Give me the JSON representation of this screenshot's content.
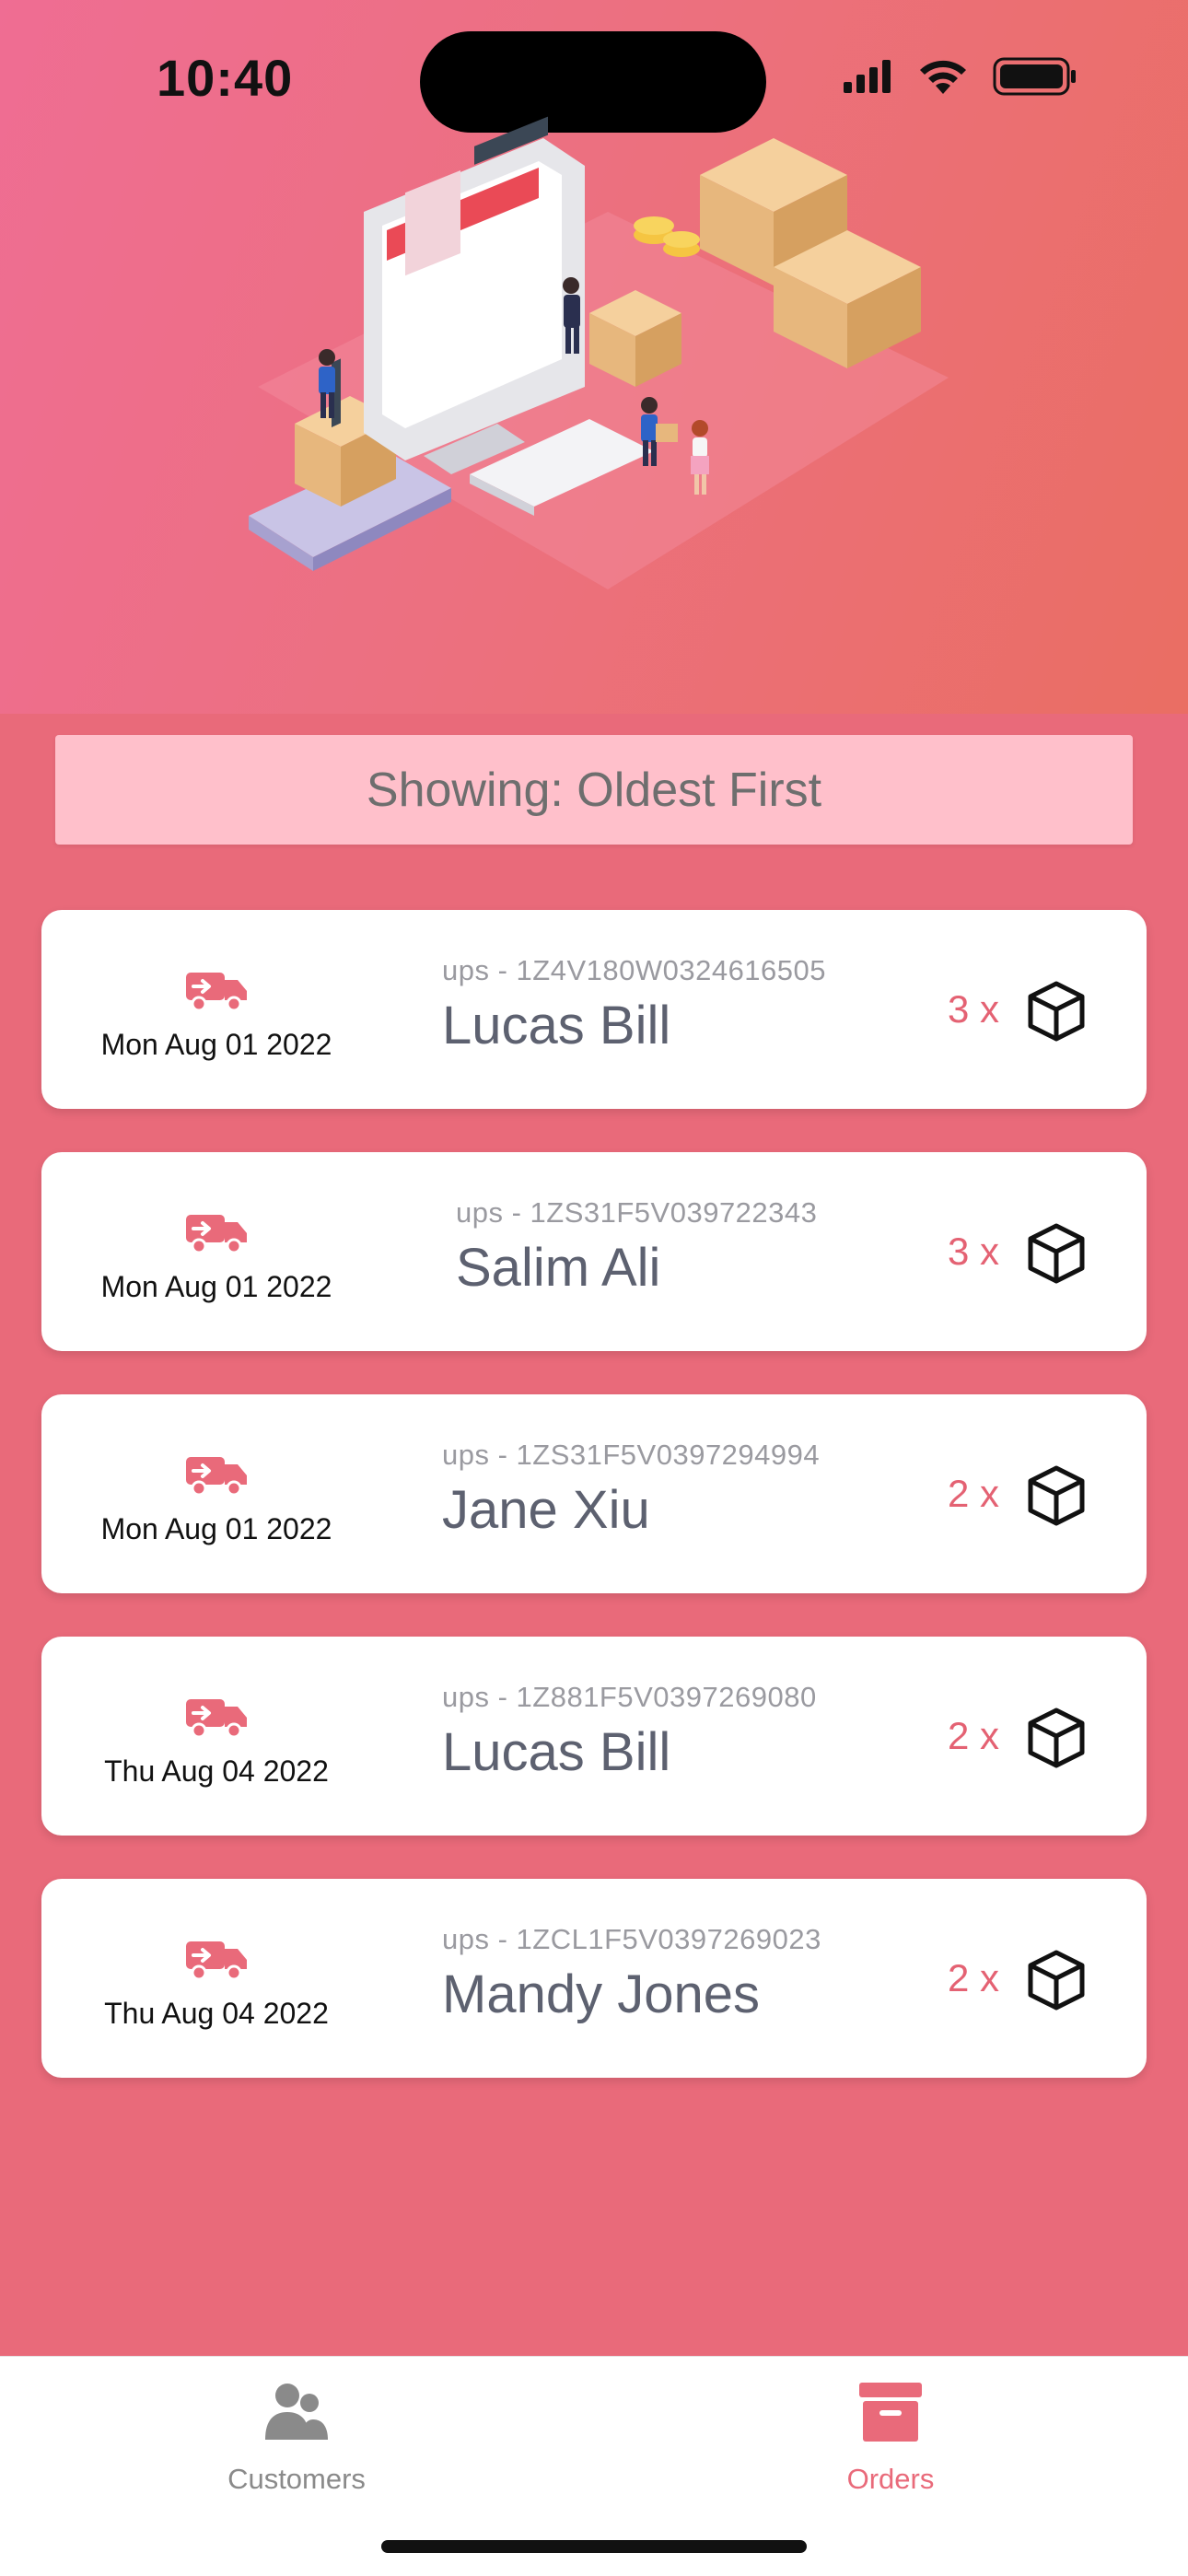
{
  "status_bar": {
    "time": "10:40"
  },
  "sort_banner": {
    "label": "Showing: Oldest First"
  },
  "orders": [
    {
      "date": "Mon Aug 01 2022",
      "tracking": "ups - 1Z4V180W0324616505",
      "customer": "Lucas Bill",
      "quantity": "3 x"
    },
    {
      "date": "Mon Aug 01 2022",
      "tracking": "ups - 1ZS31F5V039722343",
      "customer": "Salim Ali",
      "quantity": "3 x"
    },
    {
      "date": "Mon Aug 01 2022",
      "tracking": "ups - 1ZS31F5V0397294994",
      "customer": "Jane Xiu",
      "quantity": "2 x"
    },
    {
      "date": "Thu Aug 04 2022",
      "tracking": "ups - 1Z881F5V0397269080",
      "customer": "Lucas Bill",
      "quantity": "2 x"
    },
    {
      "date": "Thu Aug 04 2022",
      "tracking": "ups - 1ZCL1F5V0397269023",
      "customer": "Mandy Jones",
      "quantity": "2 x"
    }
  ],
  "tabbar": {
    "customers_label": "Customers",
    "orders_label": "Orders",
    "active": "Orders"
  },
  "colors": {
    "accent": "#e96a7a",
    "banner": "#ffc0cb",
    "quantity": "#e46273"
  },
  "icons": [
    "truck-icon",
    "box-icon",
    "customers-icon",
    "orders-icon",
    "wifi-icon",
    "battery-icon",
    "signal-icon"
  ]
}
